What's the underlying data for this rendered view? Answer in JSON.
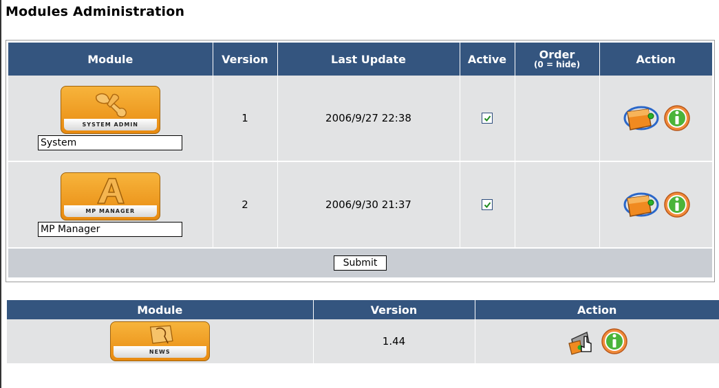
{
  "page": {
    "title": "Modules Administration"
  },
  "installed": {
    "headers": {
      "module": "Module",
      "version": "Version",
      "last_update": "Last Update",
      "active": "Active",
      "order": "Order",
      "order_hint": "(0 = hide)",
      "action": "Action"
    },
    "rows": [
      {
        "badge_label": "SYSTEM ADMIN",
        "name": "System",
        "version": "1",
        "last_update": "2006/9/27 22:38",
        "active": true,
        "order": ""
      },
      {
        "badge_label": "MP MANAGER",
        "name": "MP Manager",
        "version": "2",
        "last_update": "2006/9/30 21:37",
        "active": true,
        "order": ""
      }
    ],
    "submit_label": "Submit"
  },
  "available": {
    "headers": {
      "module": "Module",
      "version": "Version",
      "action": "Action"
    },
    "rows": [
      {
        "badge_label": "NEWS",
        "version": "1.44"
      }
    ]
  },
  "icons": {
    "badge": "module-badge-icon",
    "update": "update-module-icon",
    "info": "info-icon",
    "install": "install-module-icon",
    "check": "checkbox-checked-icon"
  },
  "colors": {
    "header_bg": "#34557f",
    "cell_bg": "#e2e3e4",
    "submit_row_bg": "#c9cdd3",
    "badge": "#f0a02a",
    "info": "#f08a3a"
  }
}
